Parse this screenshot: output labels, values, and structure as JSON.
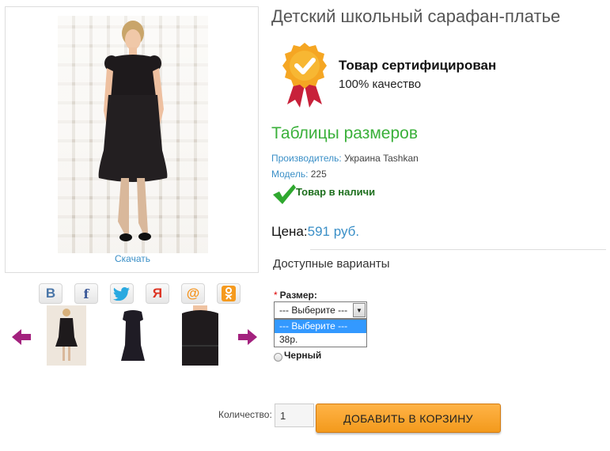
{
  "product": {
    "title": "Детский школьный сарафан-платье",
    "download_link": "Скачать"
  },
  "certificate": {
    "title": "Товар сертифицирован",
    "subtitle": "100% качество"
  },
  "size_table_link": "Таблицы размеров",
  "meta": {
    "manufacturer_label": "Производитель:",
    "manufacturer_value": " Украина Tashkan",
    "model_label": "Модель:",
    "model_value": " 225"
  },
  "stock_status": "Товар в наличи",
  "price": {
    "label": "Цена:",
    "value": "591 руб."
  },
  "variants": {
    "heading": "Доступные варианты",
    "size_label": "Размер:",
    "required_mark": "*",
    "select_value": "--- Выберите ---",
    "options": [
      "--- Выберите ---",
      "38р."
    ],
    "color_option": "Черный"
  },
  "cart": {
    "quantity_label": "Количество:",
    "quantity_value": "1",
    "add_button": "ДОБАВИТЬ В КОРЗИНУ"
  },
  "share_icons": [
    "vk-icon",
    "facebook-icon",
    "twitter-icon",
    "odnoklassniki-alt-icon",
    "mailru-icon",
    "ok-icon"
  ],
  "colors": {
    "link_blue": "#3a8fc7",
    "green": "#3ab03a",
    "orange_button": "#f39a1c"
  }
}
